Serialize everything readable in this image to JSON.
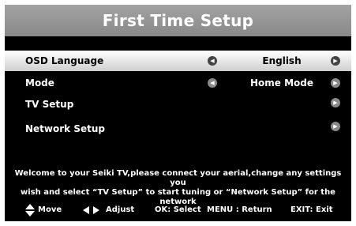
{
  "title": "First Time Setup",
  "menu": [
    {
      "label": "OSD Language",
      "value": "English",
      "left_arrow": true,
      "right_arrow": true,
      "selected": true
    },
    {
      "label": "Mode",
      "value": "Home Mode",
      "left_arrow": true,
      "right_arrow": true,
      "selected": false
    },
    {
      "label": "TV Setup",
      "value": "",
      "left_arrow": false,
      "right_arrow": true,
      "selected": false
    },
    {
      "label": "Network Setup",
      "value": "",
      "left_arrow": false,
      "right_arrow": true,
      "selected": false
    }
  ],
  "welcome_line1": "Welcome to your Seiki TV,please connect your aerial,change any settings you",
  "welcome_line2": "wish and select “TV Setup” to start tuning or “Network Setup” for the network",
  "footer": {
    "move": "Move",
    "adjust": "Adjust",
    "ok": "OK: Select",
    "menu": "MENU : Return",
    "exit": "EXIT: Exit"
  },
  "colors": {
    "title_bar": "#939393",
    "background": "#000000",
    "selected_row": "#e6e6e6",
    "arrow_button": "#8a8a8a"
  },
  "icons": {
    "left_arrow": "left-circle-arrow-icon",
    "right_arrow": "right-circle-arrow-icon",
    "move": "up-down-arrows-icon",
    "adjust": "left-right-arrows-icon"
  }
}
